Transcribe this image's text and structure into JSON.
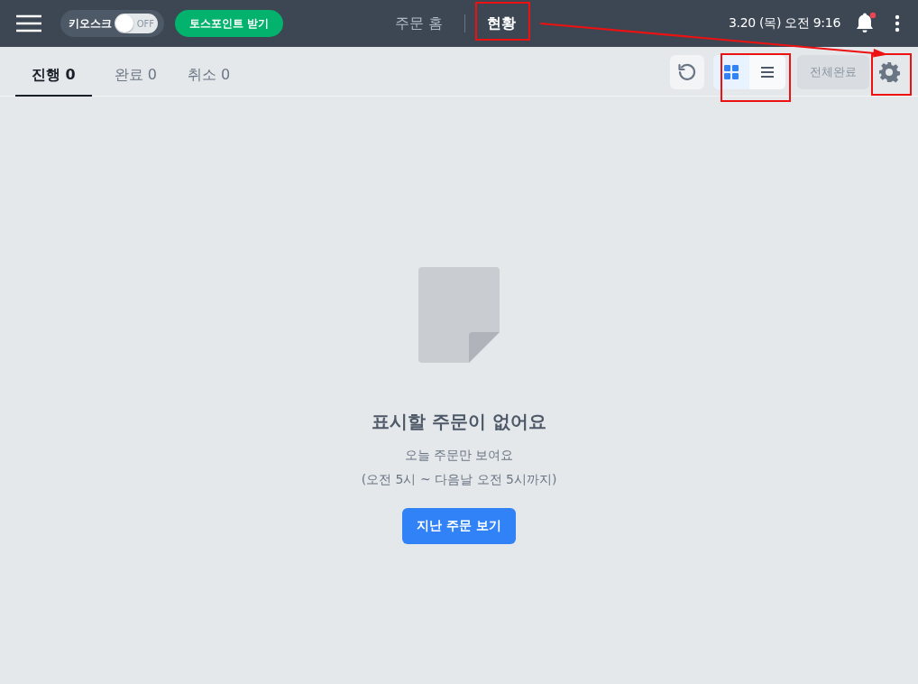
{
  "header": {
    "kiosk_toggle": {
      "label": "키오스크",
      "state_text": "OFF",
      "on": false
    },
    "toss_button": "토스포인트 받기",
    "nav": [
      {
        "label": "주문 홈",
        "selected": false
      },
      {
        "label": "현황",
        "selected": true
      }
    ],
    "datetime": "3.20 (목) 오전 9:16",
    "notification": {
      "unread": true
    }
  },
  "tabs": [
    {
      "label": "진행 0",
      "selected": true
    },
    {
      "label": "완료 0",
      "selected": false
    },
    {
      "label": "취소 0",
      "selected": false
    }
  ],
  "view_modes": [
    {
      "kind": "grid",
      "selected": true
    },
    {
      "kind": "list",
      "selected": false
    }
  ],
  "complete_all": {
    "label": "전체완료",
    "disabled": true
  },
  "empty_state": {
    "title": "표시할 주문이 없어요",
    "lines": [
      "오늘 주문만 보여요",
      "(오전 5시 ~ 다음날 오전 5시까지)"
    ],
    "button": "지난 주문 보기"
  }
}
